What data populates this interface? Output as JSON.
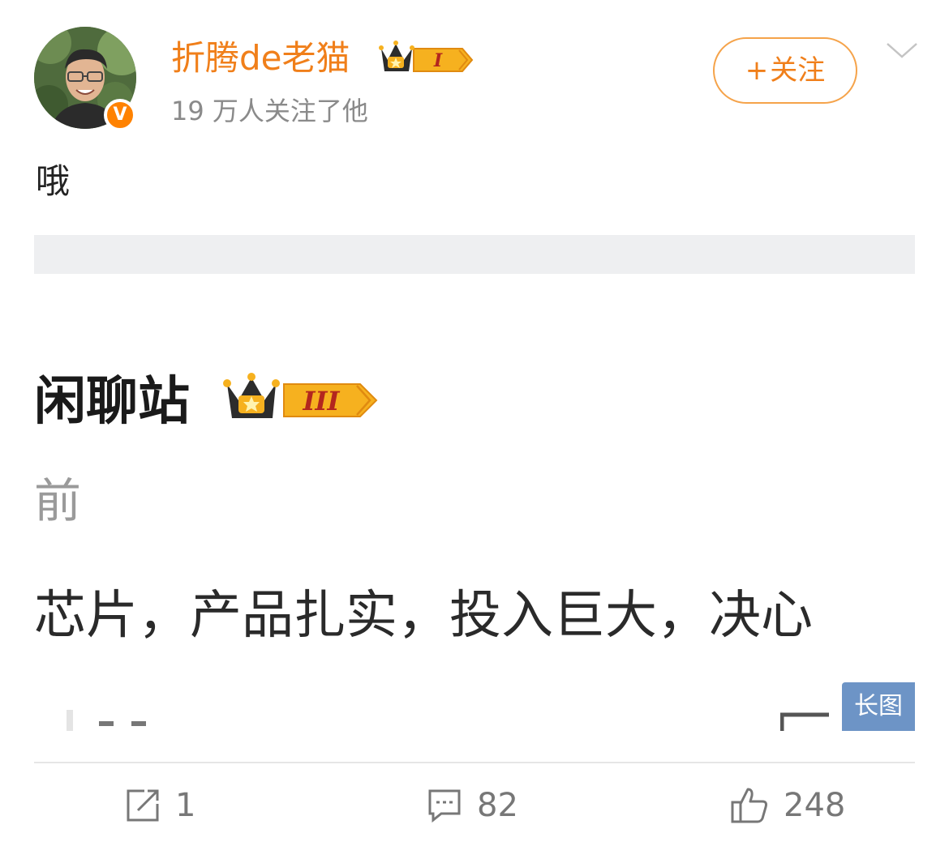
{
  "user": {
    "name": "折腾de老猫",
    "followers_text": "19 万人关注了他",
    "verified_mark": "V",
    "level_badge": "I"
  },
  "follow_button": {
    "plus": "+",
    "label": "关注"
  },
  "post": {
    "text": "哦"
  },
  "image": {
    "name": "闲聊站",
    "level_badge": "III",
    "time": "前",
    "body": "芯片，产品扎实，投入巨大，决心",
    "long_image_label": "长图"
  },
  "actions": {
    "repost_count": "1",
    "comment_count": "82",
    "like_count": "248"
  },
  "colors": {
    "accent": "#f07f1a",
    "verified": "#ff8200",
    "long_image_badge": "#6d94c6",
    "muted": "#8a8a8a"
  }
}
